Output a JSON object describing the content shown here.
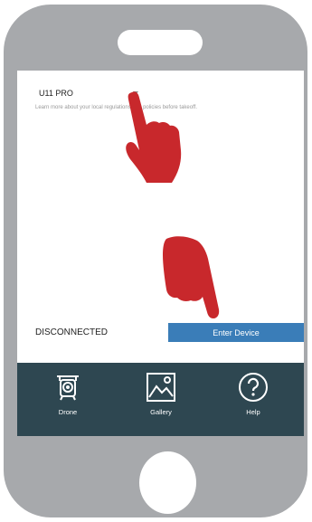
{
  "device": {
    "model": "U11 PRO",
    "regulation_notice": "Learn more about your local regulations and policies before takeoff."
  },
  "connection": {
    "status": "DISCONNECTED",
    "enter_button_label": "Enter Device"
  },
  "nav": {
    "items": [
      {
        "label": "Drone",
        "icon": "drone-icon"
      },
      {
        "label": "Gallery",
        "icon": "gallery-icon"
      },
      {
        "label": "Help",
        "icon": "help-icon"
      }
    ]
  },
  "colors": {
    "phone_body": "#a7a9ac",
    "nav_background": "#2e4751",
    "button_blue": "#3a7db8",
    "hand_red": "#c8282c"
  }
}
